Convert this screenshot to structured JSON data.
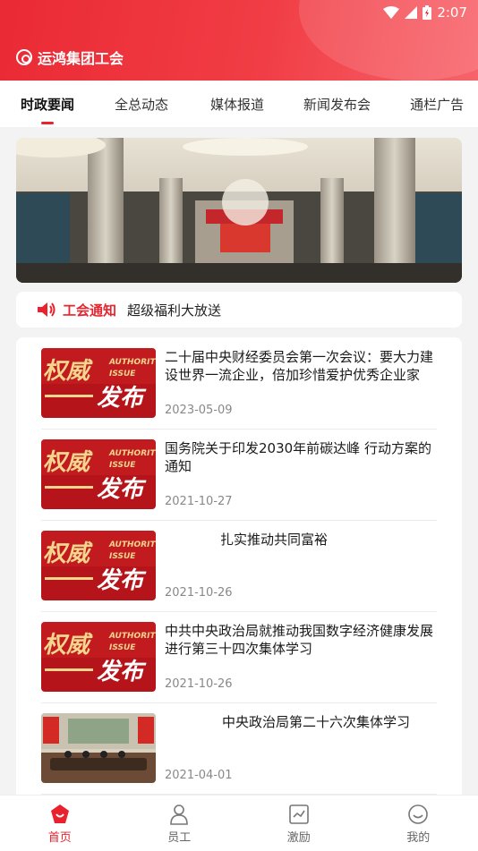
{
  "status_bar": {
    "time": "2:07"
  },
  "header": {
    "app_name": "运鸿集团工会"
  },
  "tabs": [
    {
      "label": "时政要闻",
      "active": true
    },
    {
      "label": "全总动态"
    },
    {
      "label": "媒体报道"
    },
    {
      "label": "新闻发布会"
    },
    {
      "label": "通栏广告"
    }
  ],
  "notice": {
    "tag": "工会通知",
    "text": "超级福利大放送"
  },
  "thumb_text": {
    "big1": "权威",
    "big2": "发布",
    "en1": "AUTHORIT",
    "en2": "ISSUE"
  },
  "news": [
    {
      "title": "二十届中央财经委员会第一次会议：要大力建设世界一流企业，倍加珍惜爱护优秀企业家",
      "date": "2023-05-09",
      "thumb": "authority"
    },
    {
      "title": "国务院关于印发2030年前碳达峰 行动方案的通知",
      "date": "2021-10-27",
      "thumb": "authority"
    },
    {
      "title": "扎实推动共同富裕",
      "date": "2021-10-26",
      "thumb": "authority"
    },
    {
      "title": "中共中央政治局就推动我国数字经济健康发展进行第三十四次集体学习",
      "date": "2021-10-26",
      "thumb": "authority"
    },
    {
      "title": "中央政治局第二十六次集体学习",
      "date": "2021-04-01",
      "thumb": "photo"
    }
  ],
  "bottom_nav": [
    {
      "label": "首页",
      "icon": "home-icon",
      "active": true
    },
    {
      "label": "员工",
      "icon": "person-icon"
    },
    {
      "label": "激励",
      "icon": "chart-icon"
    },
    {
      "label": "我的",
      "icon": "smile-icon"
    }
  ],
  "colors": {
    "accent": "#e8232d"
  }
}
